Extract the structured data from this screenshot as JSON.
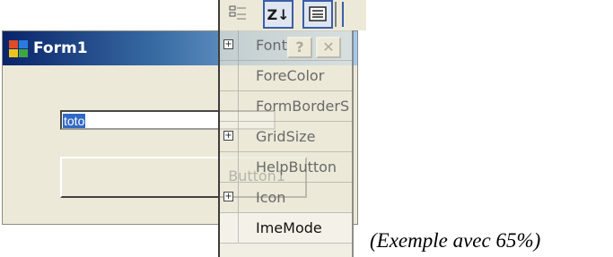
{
  "form": {
    "title": "Form1",
    "textbox_value": "toto",
    "button_label": "Button1",
    "help_glyph": "?",
    "close_glyph": "✕",
    "icon": "form-app-icon"
  },
  "property_grid": {
    "toolbar": {
      "categorized_icon": "categorized-icon",
      "sort_label": "Z↓",
      "pages_icon": "property-pages-icon"
    },
    "rows": [
      {
        "name": "Font",
        "expand": "⊞",
        "style": "faded"
      },
      {
        "name": "ForeColor",
        "expand": "",
        "style": "faded"
      },
      {
        "name": "FormBorderS",
        "expand": "",
        "style": "faded"
      },
      {
        "name": "GridSize",
        "expand": "⊞",
        "style": "faded"
      },
      {
        "name": "HelpButton",
        "expand": "",
        "style": "faded"
      },
      {
        "name": "Icon",
        "expand": "⊞",
        "style": "faded"
      },
      {
        "name": "ImeMode",
        "expand": "",
        "style": "strong"
      }
    ]
  },
  "caption": "(Exemple avec 65%)",
  "colors": {
    "title_start": "#0a246a",
    "title_end": "#a6caf0",
    "selection": "#316ac5",
    "window_bg": "#ece9d8"
  }
}
